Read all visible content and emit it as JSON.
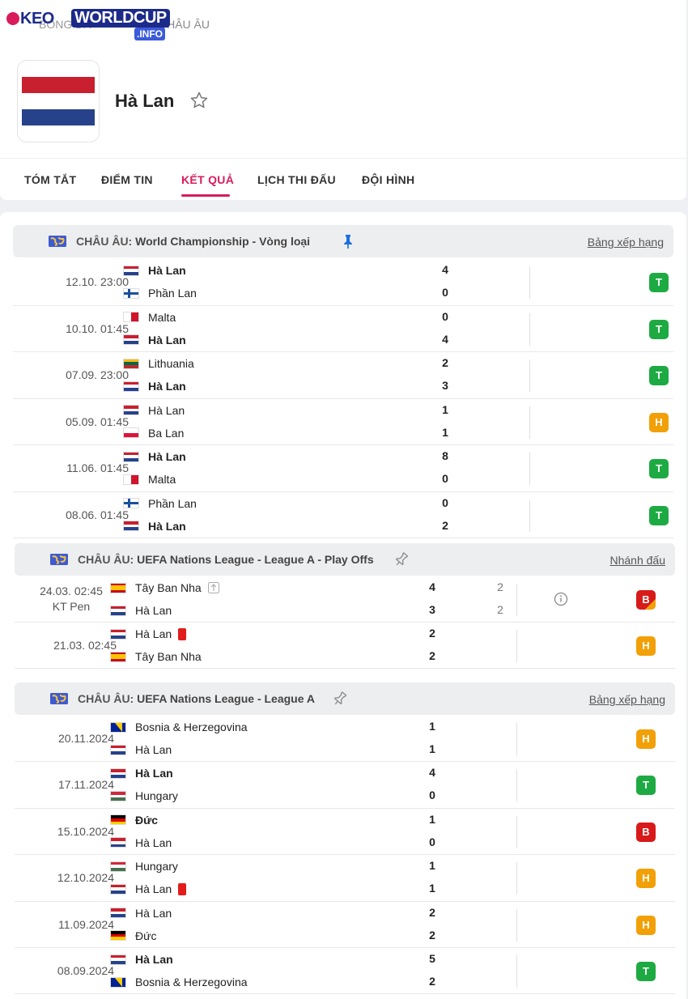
{
  "logo": {
    "keo": "KEO",
    "worldcup": "WORLDCUP",
    "info": ".INFO"
  },
  "breadcrumb": [
    "BÓNG ĐÁ",
    "CHÂU ÂU"
  ],
  "team": {
    "name": "Hà Lan"
  },
  "tabs": [
    "TÓM TẮT",
    "ĐIỂM TIN",
    "KẾT QUẢ",
    "LỊCH THI ĐẤU",
    "ĐỘI HÌNH"
  ],
  "active_tab": "KẾT QUẢ",
  "colors": {
    "accent": "#d91b5c",
    "win": "#1eaa42",
    "draw": "#f2a007",
    "loss": "#d81a1a"
  },
  "competitions": [
    {
      "region": "CHÂU ÂU:",
      "name": "World Championship - Vòng loại",
      "link": "Bảng xếp hạng",
      "pinned": true,
      "matches": [
        {
          "date": "12.10. 23:00",
          "home": "Hà Lan",
          "home_flag": "nl",
          "home_bold": true,
          "away": "Phần Lan",
          "away_flag": "fi",
          "away_bold": false,
          "home_score": "4",
          "away_score": "0",
          "result": "T"
        },
        {
          "date": "10.10. 01:45",
          "home": "Malta",
          "home_flag": "mt",
          "home_bold": false,
          "away": "Hà Lan",
          "away_flag": "nl",
          "away_bold": true,
          "home_score": "0",
          "away_score": "4",
          "result": "T"
        },
        {
          "date": "07.09. 23:00",
          "home": "Lithuania",
          "home_flag": "lt",
          "home_bold": false,
          "away": "Hà Lan",
          "away_flag": "nl",
          "away_bold": true,
          "home_score": "2",
          "away_score": "3",
          "result": "T"
        },
        {
          "date": "05.09. 01:45",
          "home": "Hà Lan",
          "home_flag": "nl",
          "home_bold": false,
          "away": "Ba Lan",
          "away_flag": "pl",
          "away_bold": false,
          "home_score": "1",
          "away_score": "1",
          "result": "H"
        },
        {
          "date": "11.06. 01:45",
          "home": "Hà Lan",
          "home_flag": "nl",
          "home_bold": true,
          "away": "Malta",
          "away_flag": "mt",
          "away_bold": false,
          "home_score": "8",
          "away_score": "0",
          "result": "T"
        },
        {
          "date": "08.06. 01:45",
          "home": "Phần Lan",
          "home_flag": "fi",
          "home_bold": false,
          "away": "Hà Lan",
          "away_flag": "nl",
          "away_bold": true,
          "home_score": "0",
          "away_score": "2",
          "result": "T"
        }
      ]
    },
    {
      "region": "CHÂU ÂU:",
      "name": "UEFA Nations League - League A - Play Offs",
      "link": "Nhánh đấu",
      "pinned": false,
      "matches": [
        {
          "date": "24.03. 02:45",
          "date_note": "KT Pen",
          "home": "Tây Ban Nha",
          "home_flag": "es",
          "home_bold": false,
          "away": "Hà Lan",
          "away_flag": "nl",
          "away_bold": false,
          "home_score": "4",
          "away_score": "3",
          "home_pen": "2",
          "away_pen": "2",
          "result": "B"
        },
        {
          "date": "21.03. 02:45",
          "home": "Hà Lan",
          "home_flag": "nl",
          "home_bold": false,
          "away": "Tây Ban Nha",
          "away_flag": "es",
          "away_bold": false,
          "home_score": "2",
          "away_score": "2",
          "result": "H"
        }
      ]
    },
    {
      "region": "CHÂU ÂU:",
      "name": "UEFA Nations League - League A",
      "link": "Bảng xếp hạng",
      "pinned": false,
      "matches": [
        {
          "date": "20.11.2024",
          "home": "Bosnia & Herzegovina",
          "home_flag": "ba",
          "home_bold": false,
          "away": "Hà Lan",
          "away_flag": "nl",
          "away_bold": false,
          "home_score": "1",
          "away_score": "1",
          "result": "H"
        },
        {
          "date": "17.11.2024",
          "home": "Hà Lan",
          "home_flag": "nl",
          "home_bold": true,
          "away": "Hungary",
          "away_flag": "hu",
          "away_bold": false,
          "home_score": "4",
          "away_score": "0",
          "result": "T"
        },
        {
          "date": "15.10.2024",
          "home": "Đức",
          "home_flag": "de",
          "home_bold": true,
          "away": "Hà Lan",
          "away_flag": "nl",
          "away_bold": false,
          "home_score": "1",
          "away_score": "0",
          "result": "B"
        },
        {
          "date": "12.10.2024",
          "home": "Hungary",
          "home_flag": "hu",
          "home_bold": false,
          "away": "Hà Lan",
          "away_flag": "nl",
          "away_bold": false,
          "home_score": "1",
          "away_score": "1",
          "result": "H"
        },
        {
          "date": "11.09.2024",
          "home": "Hà Lan",
          "home_flag": "nl",
          "home_bold": false,
          "away": "Đức",
          "away_flag": "de",
          "away_bold": false,
          "home_score": "2",
          "away_score": "2",
          "result": "H"
        },
        {
          "date": "08.09.2024",
          "home": "Hà Lan",
          "home_flag": "nl",
          "home_bold": true,
          "away": "Bosnia & Herzegovina",
          "away_flag": "ba",
          "away_bold": false,
          "home_score": "5",
          "away_score": "2",
          "result": "T"
        }
      ]
    }
  ]
}
